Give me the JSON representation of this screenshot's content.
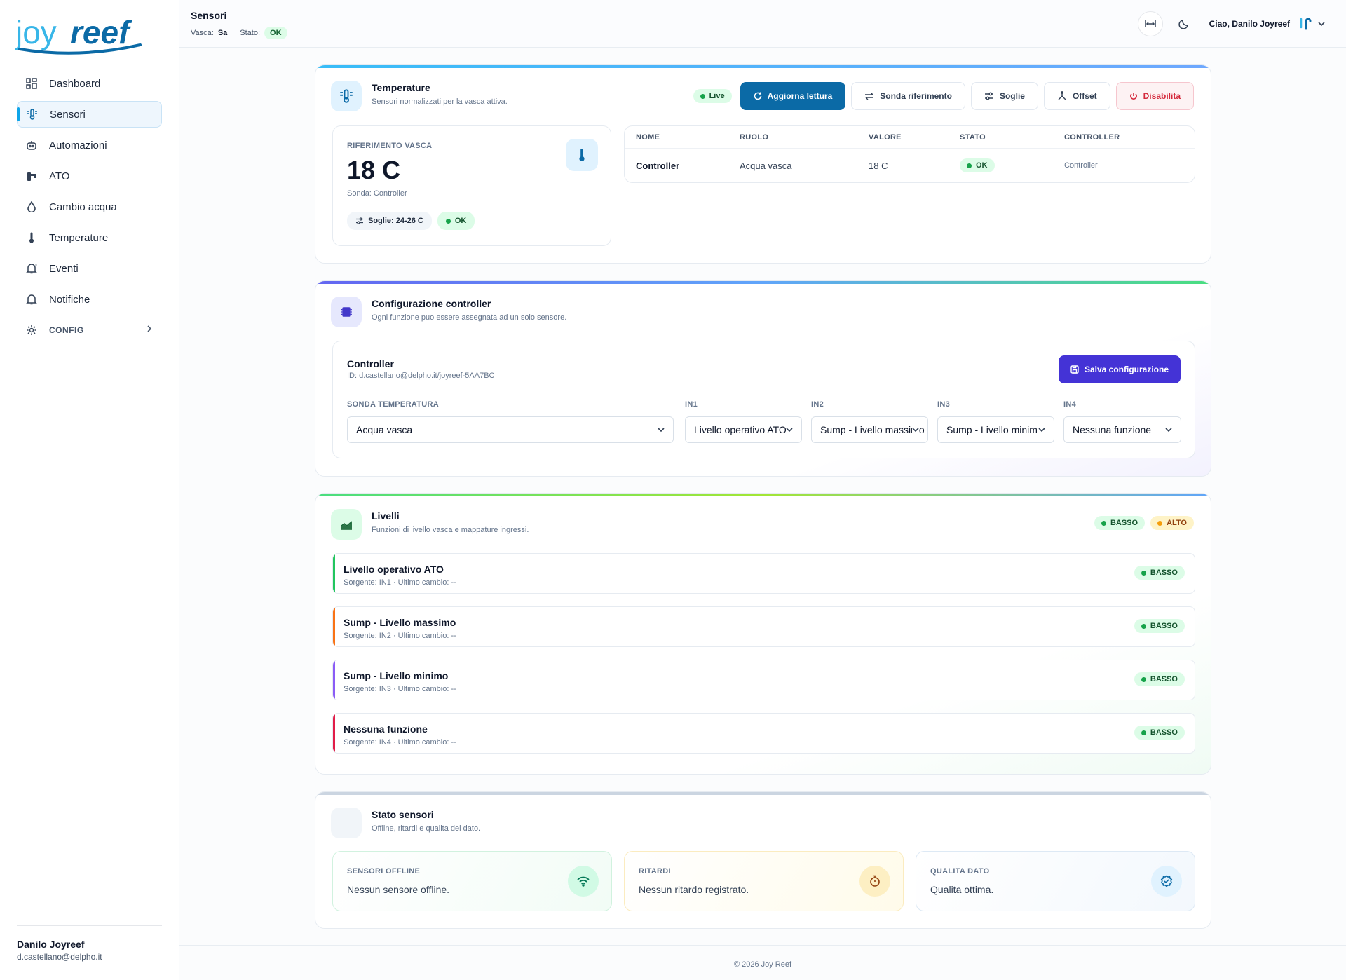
{
  "app": {
    "logo_text": "joyreef",
    "logo_part1": "joy",
    "logo_part2": "reef",
    "accent": "#0ea5e9"
  },
  "sidebar": {
    "items": [
      {
        "label": "Dashboard",
        "icon": "grid-icon"
      },
      {
        "label": "Sensori",
        "icon": "sensor-icon",
        "active": true
      },
      {
        "label": "Automazioni",
        "icon": "robot-icon"
      },
      {
        "label": "ATO",
        "icon": "faucet-icon"
      },
      {
        "label": "Cambio acqua",
        "icon": "droplet-icon"
      },
      {
        "label": "Temperature",
        "icon": "thermometer-icon"
      },
      {
        "label": "Eventi",
        "icon": "bell-alert-icon"
      },
      {
        "label": "Notifiche",
        "icon": "bell-icon"
      },
      {
        "label": "CONFIG",
        "icon": "gear-icon"
      }
    ],
    "user": {
      "name": "Danilo Joyreef",
      "email": "d.castellano@delpho.it"
    }
  },
  "topbar": {
    "title": "Sensori",
    "tank_label": "Vasca:",
    "tank_value": "Sa",
    "status_label": "Stato:",
    "status_value": "OK",
    "greeting": "Ciao, Danilo Joyreef",
    "avatar_initials": "JR"
  },
  "temperature": {
    "title": "Temperature",
    "subtitle": "Sensori normalizzati per la vasca attiva.",
    "live": "Live",
    "buttons": {
      "refresh": "Aggiorna lettura",
      "reference": "Sonda riferimento",
      "thresholds": "Soglie",
      "offset": "Offset",
      "disable": "Disabilita"
    },
    "ref_label": "RIFERIMENTO VASCA",
    "ref_value": "18 C",
    "ref_probe": "Sonda: Controller",
    "thresholds_badge": "Soglie: 24-26 C",
    "status_badge": "OK",
    "table": {
      "headers": [
        "NOME",
        "RUOLO",
        "VALORE",
        "STATO",
        "CONTROLLER"
      ],
      "rows": [
        {
          "name": "Controller",
          "role": "Acqua vasca",
          "value": "18 C",
          "status": "OK",
          "controller": "Controller"
        }
      ]
    }
  },
  "controller_config": {
    "title": "Configurazione controller",
    "subtitle": "Ogni funzione puo essere assegnata ad un solo sensore.",
    "name": "Controller",
    "id": "ID: d.castellano@delpho.it/joyreef-5AA7BC",
    "save": "Salva configurazione",
    "fields": {
      "temp_label": "SONDA TEMPERATURA",
      "temp_value": "Acqua vasca",
      "in1_label": "IN1",
      "in1_value": "Livello operativo ATO",
      "in2_label": "IN2",
      "in2_value": "Sump - Livello massimo",
      "in3_label": "IN3",
      "in3_value": "Sump - Livello minimo",
      "in4_label": "IN4",
      "in4_value": "Nessuna funzione"
    }
  },
  "levels": {
    "title": "Livelli",
    "subtitle": "Funzioni di livello vasca e mappature ingressi.",
    "legend_low": "BASSO",
    "legend_high": "ALTO",
    "items": [
      {
        "title": "Livello operativo ATO",
        "source": "Sorgente: IN1 · Ultimo cambio: --",
        "state": "BASSO",
        "accent": "#22c55e"
      },
      {
        "title": "Sump - Livello massimo",
        "source": "Sorgente: IN2 · Ultimo cambio: --",
        "state": "BASSO",
        "accent": "#f97316"
      },
      {
        "title": "Sump - Livello minimo",
        "source": "Sorgente: IN3 · Ultimo cambio: --",
        "state": "BASSO",
        "accent": "#8b5cf6"
      },
      {
        "title": "Nessuna funzione",
        "source": "Sorgente: IN4 · Ultimo cambio: --",
        "state": "BASSO",
        "accent": "#e11d48"
      }
    ]
  },
  "sensor_status": {
    "title": "Stato sensori",
    "subtitle": "Offline, ritardi e qualita del dato.",
    "offline_label": "SENSORI OFFLINE",
    "offline_value": "Nessun sensore offline.",
    "delay_label": "RITARDI",
    "delay_value": "Nessun ritardo registrato.",
    "quality_label": "QUALITA DATO",
    "quality_value": "Qualita ottima."
  },
  "footer": {
    "text": "© 2026 Joy Reef"
  }
}
